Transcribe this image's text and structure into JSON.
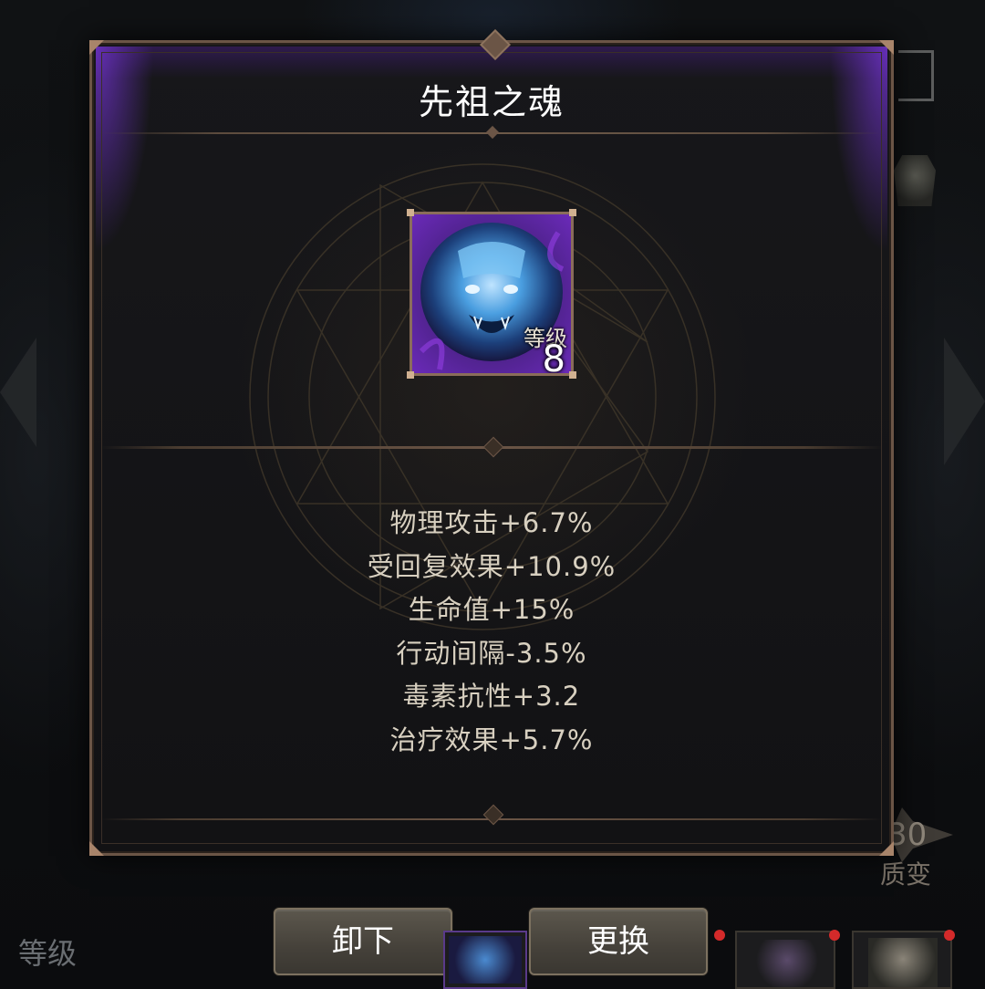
{
  "dialog": {
    "title": "先祖之魂",
    "item": {
      "icon": "blue-spirit-beast-icon",
      "level_label": "等级",
      "level_value": "8"
    },
    "stats": [
      "物理攻击+6.7%",
      "受回复效果+10.9%",
      "生命值+15%",
      "行动间隔-3.5%",
      "毒素抗性+3.2",
      "治疗效果+5.7%"
    ]
  },
  "actions": {
    "unequip_label": "卸下",
    "replace_label": "更换"
  },
  "background": {
    "level_label": "等级",
    "quality_value": "30",
    "quality_label": "质变"
  },
  "colors": {
    "panel_border": "#6b5546",
    "rarity_glow": "#6e32c8",
    "stat_text": "#d8d0c0",
    "title_text": "#ffffff"
  }
}
